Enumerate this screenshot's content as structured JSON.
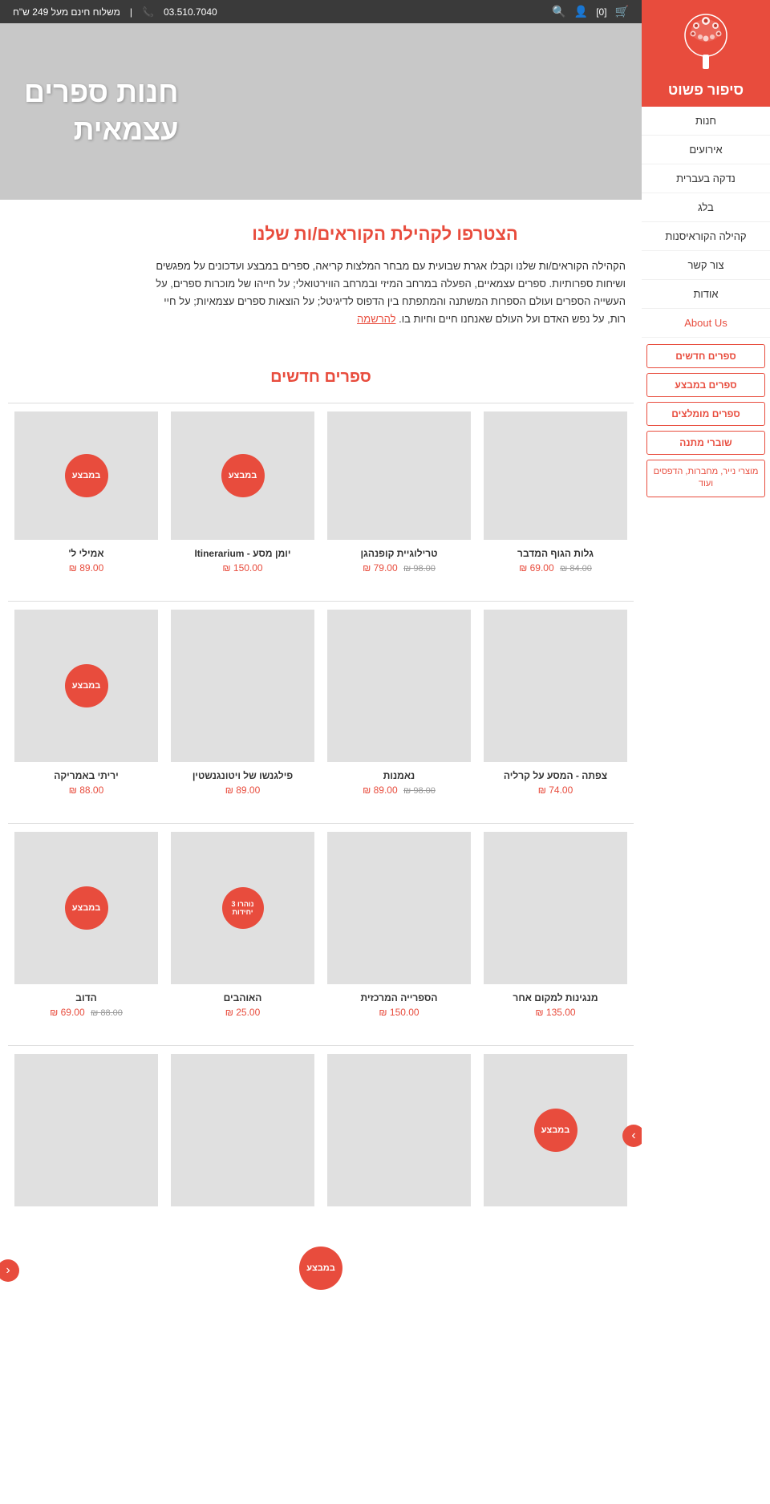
{
  "topbar": {
    "phone": "03.510.7040",
    "shipping": "משלוח חינם מעל 249 ש\"ח",
    "icons": [
      "cart",
      "user",
      "search"
    ],
    "cart_label": "[0]",
    "separator": "|"
  },
  "hero": {
    "title_line1": "חנות ספרים",
    "title_line2": "עצמאית"
  },
  "join": {
    "title": "הצטרפו לקהילת הקוראים/ות שלנו",
    "text": "הקהילה הקוראים/ות שלנו וקבלו אגרת שבועית עם מבחר המלצות קריאה, ספרים במבצע ועדכונים על מפגשים ושיחות ספרותיות. ספרים עצמאיים, הפעלה במרחב המיזי ובמרחב הווירטואלי; על חייהו של מוכרות ספרים, על העשייה הספרים ועולם הספרות המשתנה והמתפתח בין הדפוס לדיגיטל; על הוצאות ספרים עצמאיות; על חיי רות, על נפש האדם ועל העולם שאנחנו חיים וחיות בו.",
    "link_text": "להרשמה"
  },
  "sidebar": {
    "logo_text": "סיפור פשוט",
    "nav_items": [
      {
        "label": "חנות",
        "active": false
      },
      {
        "label": "אירועים",
        "active": false
      },
      {
        "label": "נדקה בעברית",
        "active": false
      },
      {
        "label": "בלג",
        "active": false
      },
      {
        "label": "קהילה הקוראיסנות",
        "active": false
      },
      {
        "label": "צור קשר",
        "active": false
      },
      {
        "label": "אודות",
        "active": false
      },
      {
        "label": "About Us",
        "active": true
      }
    ],
    "buttons": [
      {
        "label": "ספרים חדשים",
        "type": "outline"
      },
      {
        "label": "ספרים במבצע",
        "type": "outline"
      },
      {
        "label": "ספרים מומלצים",
        "type": "outline"
      },
      {
        "label": "שוברי מתנה",
        "type": "outline"
      },
      {
        "label": "מוצרי נייר, מחברות, הדפסים ועוד",
        "type": "multi"
      }
    ]
  },
  "new_books_section": {
    "title": "ספרים חדשים"
  },
  "books_row1": [
    {
      "title": "גלות הגוף המדבר",
      "price": "69.00 ₪",
      "old_price": "84.00 ₪",
      "badge": null
    },
    {
      "title": "טרילוגיית קופנהגן",
      "price": "79.00 ₪",
      "old_price": "98.00 ₪",
      "badge": null
    },
    {
      "title": "יומן מסע - Itinerarium",
      "price": "150.00 ₪",
      "old_price": null,
      "badge": "במבצע"
    },
    {
      "title": "אמילי ל'",
      "price": "89.00 ₪",
      "old_price": null,
      "badge": "במבצע"
    }
  ],
  "books_row2": [
    {
      "title": "צפתה - המסע על קרליה",
      "price": "74.00 ₪",
      "old_price": null,
      "badge": null
    },
    {
      "title": "נאמנות",
      "price": "89.00 ₪",
      "old_price": "98.00 ₪",
      "badge": null
    },
    {
      "title": "פילגנשו של ויטונגנשטין",
      "price": "89.00 ₪",
      "old_price": null,
      "badge": null
    },
    {
      "title": "יריתי באמריקה",
      "price": "88.00 ₪",
      "old_price": null,
      "badge": "במבצע"
    }
  ],
  "books_row3": [
    {
      "title": "מנגינות למקום אחר",
      "price": "135.00 ₪",
      "old_price": null,
      "badge": null
    },
    {
      "title": "הספרייה המרכזית",
      "price": "150.00 ₪",
      "old_price": null,
      "badge": null
    },
    {
      "title": "האוהבים",
      "price": "25.00 ₪",
      "old_price": null,
      "badge": "נוהרו 3 יחידות"
    },
    {
      "title": "הדוב",
      "price": "69.00 ₪",
      "old_price": "88.00 ₪",
      "badge": "במבצע"
    }
  ],
  "books_row4_partial": [
    {
      "title": "",
      "price": "",
      "old_price": null,
      "badge": "במבצע"
    }
  ]
}
